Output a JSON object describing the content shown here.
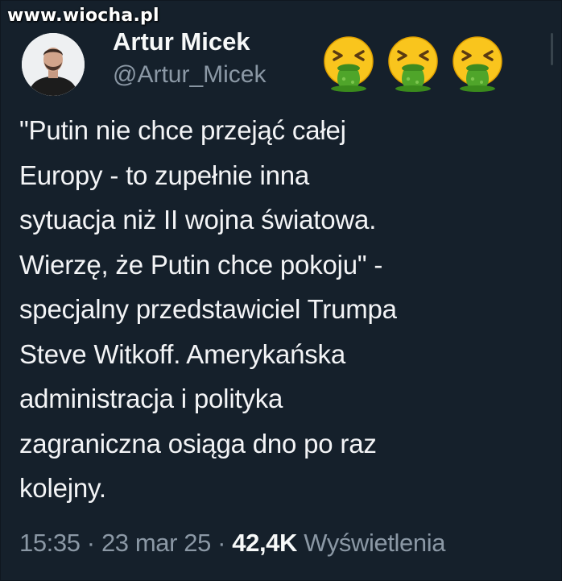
{
  "watermark": "www.wiocha.pl",
  "author": {
    "display_name": "Artur Micek",
    "handle": "@Artur_Micek",
    "avatar_icon": "person-avatar-icon"
  },
  "emojis": [
    {
      "icon": "vomiting-face-emoji-icon"
    },
    {
      "icon": "vomiting-face-emoji-icon"
    },
    {
      "icon": "vomiting-face-emoji-icon"
    }
  ],
  "tweet": {
    "text": "\"Putin nie chce przejąć całej\nEuropy - to zupełnie inna\nsytuacja niż II wojna światowa.\nWierzę, że Putin chce pokoju\" -\nspecjalny przedstawiciel Trumpa\nSteve Witkoff. Amerykańska\nadministracja i polityka\nzagraniczna osiąga dno po raz\nkolejny."
  },
  "meta": {
    "time": "15:35",
    "separator": " · ",
    "date": "23 mar 25",
    "views_count": "42,4K",
    "views_label": " Wyświetlenia"
  },
  "colors": {
    "background": "#15202b",
    "text_primary": "#f3f4f6",
    "text_secondary": "#8b98a5"
  }
}
